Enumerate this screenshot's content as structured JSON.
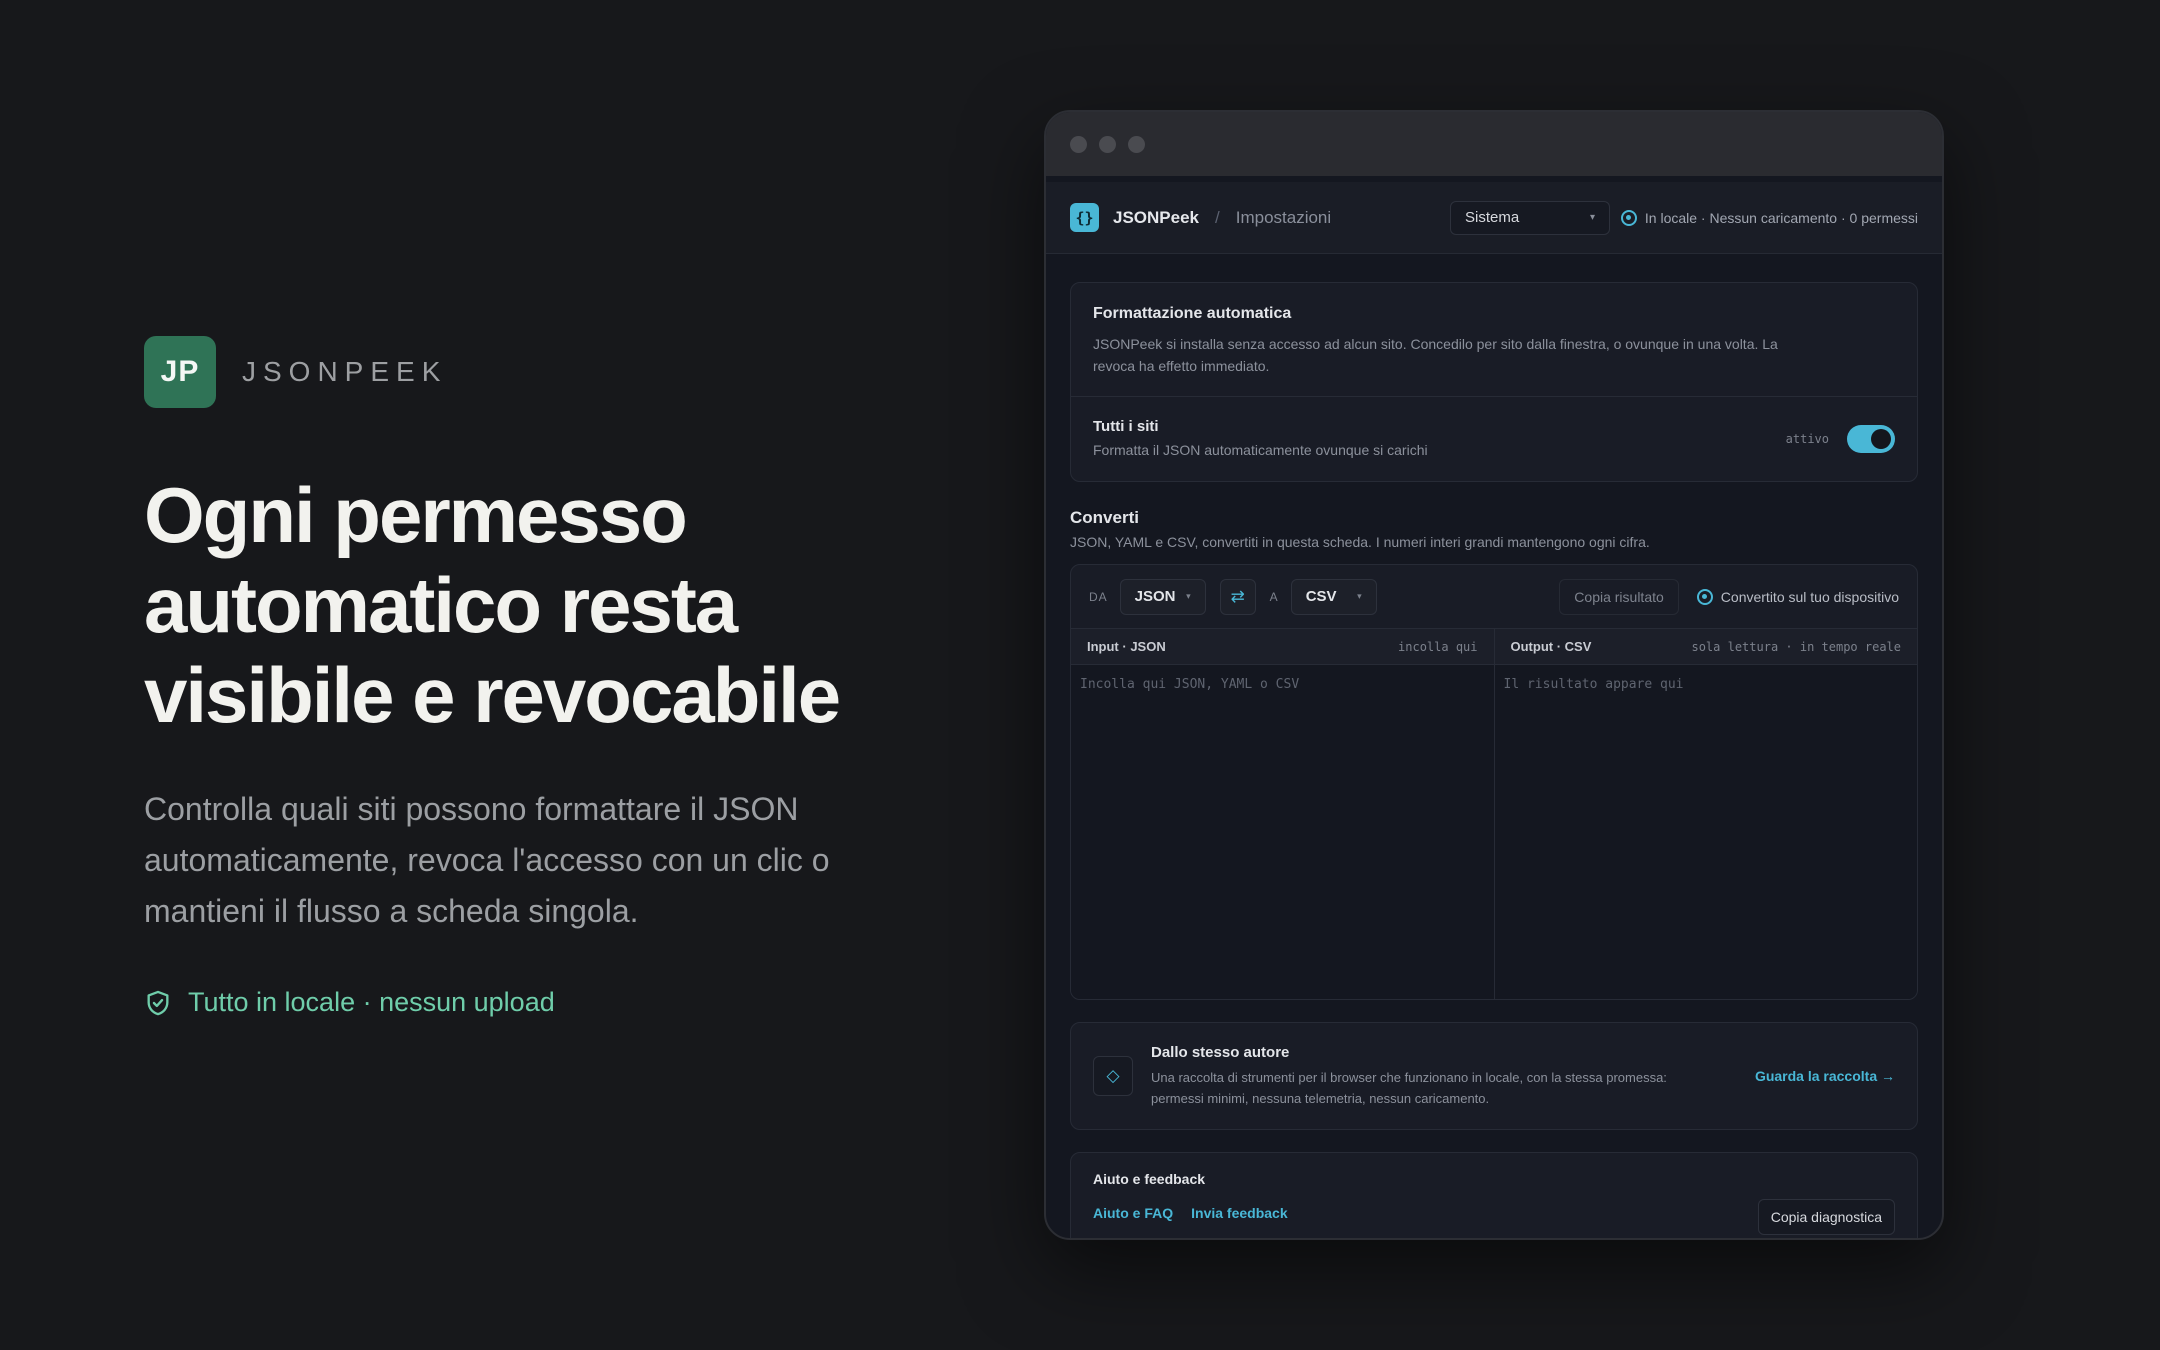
{
  "hero": {
    "badge": "JP",
    "brand": "JSONPEEK",
    "headline": "Ogni permesso automatico resta visibile e revocabile",
    "subtext": "Controlla quali siti possono formattare il JSON automaticamente, revoca l'accesso con un clic o mantieni il flusso a scheda singola.",
    "local_note": "Tutto in locale · nessun upload",
    "accent": "#6fcdaa",
    "badge_color": "#2f7356"
  },
  "app": {
    "name": "JSONPeek",
    "breadcrumb_sep": "/",
    "page": "Impostazioni",
    "theme_value": "Sistema",
    "privacy": "In locale · Nessun caricamento · 0 permessi",
    "accent": "#49b7d6"
  },
  "auto_format": {
    "title": "Formattazione automatica",
    "description": "JSONPeek si installa senza accesso ad alcun sito. Concedilo per sito dalla finestra, o ovunque in una volta. La revoca ha effetto immediato.",
    "all_sites_label": "Tutti i siti",
    "all_sites_desc": "Formatta il JSON automaticamente ovunque si carichi",
    "toggle_state": "attivo"
  },
  "convert": {
    "title": "Converti",
    "subtitle": "JSON, YAML e CSV, convertiti in questa scheda. I numeri interi grandi mantengono ogni cifra.",
    "from_label": "DA",
    "from_value": "JSON",
    "to_label": "A",
    "to_value": "CSV",
    "copy_result": "Copia risultato",
    "on_device": "Convertito sul tuo dispositivo",
    "input_title": "Input · JSON",
    "input_hint": "incolla qui",
    "input_placeholder": "Incolla qui JSON, YAML o CSV",
    "output_title": "Output · CSV",
    "output_hint": "sola lettura · in tempo reale",
    "output_placeholder": "Il risultato appare qui"
  },
  "author": {
    "title": "Dallo stesso autore",
    "description": "Una raccolta di strumenti per il browser che funzionano in locale, con la stessa promessa: permessi minimi, nessuna telemetria, nessun caricamento.",
    "link": "Guarda la raccolta →"
  },
  "help": {
    "title": "Aiuto e feedback",
    "faq": "Aiuto e FAQ",
    "feedback": "Invia feedback",
    "diagnostics": "Copia diagnostica"
  }
}
